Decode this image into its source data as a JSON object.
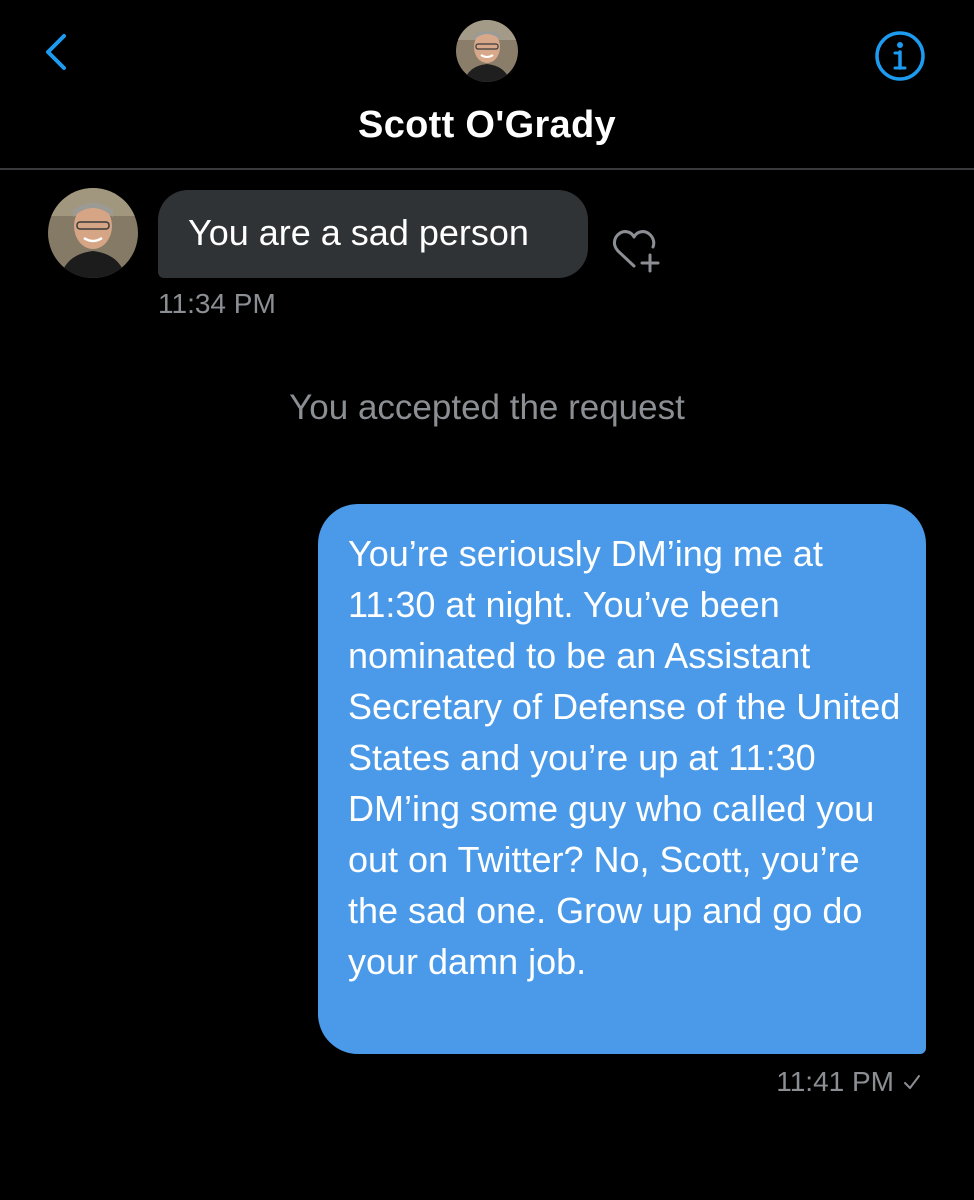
{
  "header": {
    "title": "Scott O'Grady",
    "back_icon": "chevron-left-icon",
    "info_icon": "info-circle-icon"
  },
  "messages": {
    "incoming": {
      "text": "You are a sad person",
      "time": "11:34 PM"
    },
    "system": "You accepted the request",
    "outgoing": {
      "text": "You’re seriously DM’ing me at 11:30 at night. You’ve been nominated to be an Assistant Secretary of Defense of the United States and you’re up at 11:30 DM’ing some guy who called you out on Twitter? No, Scott, you’re the sad one. Grow up and go do your damn job.",
      "time": "11:41 PM"
    }
  },
  "colors": {
    "background": "#000000",
    "accent": "#1d9bf0",
    "incoming_bubble": "#2f3336",
    "outgoing_bubble": "#4a9ae9",
    "muted_text": "#8b8e93"
  }
}
